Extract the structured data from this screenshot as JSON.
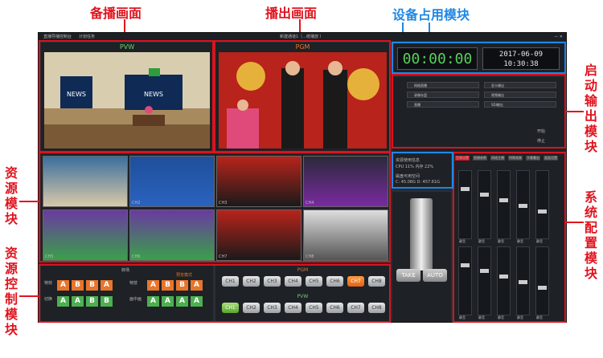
{
  "annotations": {
    "preview_screen": "备播画面",
    "output_screen": "播出画面",
    "device_usage": "设备占用模块",
    "start_output": "启动输出模块",
    "resource": "资源模块",
    "resource_control": "资源控制模块",
    "system_config": "系统配置模块"
  },
  "titlebar": {
    "menu1": "直播导播控制台",
    "menu2": "计划任务",
    "center": "新建通道1（...统播放 ）",
    "close": "— ✕"
  },
  "pvw_label": "PVW",
  "pgm_label": "PGM",
  "clock": {
    "timer": "00:00:00",
    "date": "2017-06-09",
    "time": "10:30:38"
  },
  "start_panel": {
    "rows": [
      "网络直播",
      "录像存盘",
      "直播",
      "显卡输出",
      "视频输出",
      "SDI输出"
    ],
    "start": "开始",
    "stop": "停止"
  },
  "device_info": {
    "title": "资源使用信息",
    "cpu": "CPU 11% 内存 22%",
    "disk_title": "磁盘可用空间",
    "disk": "C: 45.08G D: 457.61G"
  },
  "resource_tiles": [
    "CH1",
    "CH2",
    "CH3",
    "CH4",
    "CH5",
    "CH6",
    "CH7",
    "CH8"
  ],
  "control": {
    "transition": "转场",
    "effects_label": "特效",
    "mode_label": "切换",
    "a_label": "特技",
    "b_label": "画中画",
    "preview_label": "预览模式",
    "ab_row1": [
      "A",
      "B",
      "B",
      "A"
    ],
    "ab_row2": [
      "A",
      "A",
      "B",
      "B"
    ],
    "ab_row3": [
      "A",
      "B",
      "B",
      "A"
    ],
    "ab_row4": [
      "A",
      "A",
      "A",
      "A"
    ],
    "pgm": "PGM",
    "pvw": "PVW",
    "channels": [
      "CH1",
      "CH2",
      "CH3",
      "CH4",
      "CH5",
      "CH6",
      "CH7",
      "CH8"
    ],
    "take": "TAKE",
    "auto": "AUTO"
  },
  "mixer": {
    "tabs": [
      "音频设置",
      "直播参数",
      "网络主播",
      "特殊效果",
      "字幕叠加",
      "画面设置"
    ],
    "mute": "静音"
  }
}
